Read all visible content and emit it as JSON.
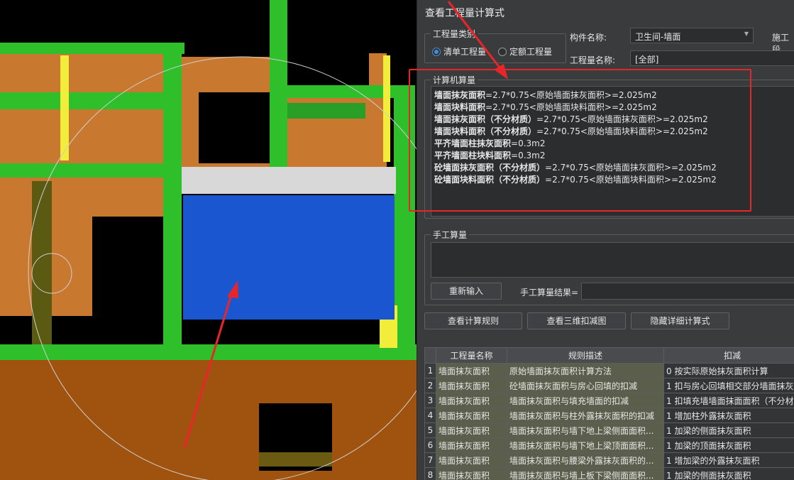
{
  "dialog": {
    "title": "查看工程量计算式",
    "category_group": {
      "label": "工程量类别",
      "options": [
        {
          "label": "清单工程量",
          "selected": true
        },
        {
          "label": "定额工程量",
          "selected": false
        }
      ]
    },
    "component_name_label": "构件名称:",
    "component_name_value": "卫生间-墙面",
    "cutoff_label": "施工段",
    "quantity_name_label": "工程量名称:",
    "quantity_name_value": "[全部]",
    "computer_group": {
      "label": "计算机算量",
      "lines": [
        {
          "name": "墙面抹灰面积",
          "expr": "=2.7*0.75<原始墙面抹灰面积>=2.025m2"
        },
        {
          "name": "墙面块料面积",
          "expr": "=2.7*0.75<原始墙面块料面积>=2.025m2"
        },
        {
          "name": "墙面抹灰面积（不分材质）",
          "expr": "=2.7*0.75<原始墙面抹灰面积>=2.025m2"
        },
        {
          "name": "墙面块料面积（不分材质）",
          "expr": "=2.7*0.75<原始墙面块料面积>=2.025m2"
        },
        {
          "name": "平齐墙面柱抹灰面积",
          "expr": "=0.3m2"
        },
        {
          "name": "平齐墙面柱块料面积",
          "expr": "=0.3m2"
        },
        {
          "name": "砼墙面抹灰面积（不分材质）",
          "expr": "=2.7*0.75<原始墙面抹灰面积>=2.025m2"
        },
        {
          "name": "砼墙面块料面积（不分材质）",
          "expr": "=2.7*0.75<原始墙面块料面积>=2.025m2"
        }
      ]
    },
    "manual_group": {
      "label": "手工算量",
      "reinput_button": "重新输入",
      "result_label": "手工算量结果="
    },
    "buttons": {
      "view_rules": "查看计算规则",
      "view_3d": "查看三维扣减图",
      "hide_detail": "隐藏详细计算式"
    },
    "table": {
      "headers": [
        "",
        "工程量名称",
        "规则描述",
        "扣减"
      ],
      "rows": [
        {
          "idx": "1",
          "name": "墙面抹灰面积",
          "desc": "原始墙面抹灰面积计算方法",
          "deduct": "0 按实际原始抹灰面积计算"
        },
        {
          "idx": "2",
          "name": "墙面抹灰面积",
          "desc": "砼墙面抹灰面积与房心回填的扣减",
          "deduct": "1 扣与房心回填相交部分墙面抹灰"
        },
        {
          "idx": "3",
          "name": "墙面抹灰面积",
          "desc": "墙面抹灰面积与填充墙面的扣减",
          "deduct": "1 扣填充墙墙面抹面面积（不分材"
        },
        {
          "idx": "4",
          "name": "墙面抹灰面积",
          "desc": "墙面抹灰面积与柱外露抹灰面积的扣减",
          "deduct": "1 增加柱外露抹灰面积"
        },
        {
          "idx": "5",
          "name": "墙面抹灰面积",
          "desc": "墙面抹灰面积与墙下地上梁侧面面积...",
          "deduct": "1 加梁的侧面抹灰面积"
        },
        {
          "idx": "6",
          "name": "墙面抹灰面积",
          "desc": "墙面抹灰面积与墙下地上梁顶面面积...",
          "deduct": "1 加梁的顶面抹灰面积"
        },
        {
          "idx": "7",
          "name": "墙面抹灰面积",
          "desc": "墙面抹灰面积与腰梁外露抹灰面积的...",
          "deduct": "1 增加梁的外露抹灰面积"
        },
        {
          "idx": "8",
          "name": "墙面抹灰面积",
          "desc": "墙面抹灰面积与墙上板下梁侧面面积...",
          "deduct": "1 加梁的侧面抹灰面积"
        }
      ]
    }
  },
  "colors": {
    "panel_bg": "#3a3b3d",
    "wall_orange": "#c9782f",
    "floor_brown": "#a0530f",
    "column_green": "#2fbf2a",
    "beam_yellow": "#f2ec3a",
    "selected_wall_blue": "#1a56cf",
    "highlight_red": "#e8262a"
  }
}
